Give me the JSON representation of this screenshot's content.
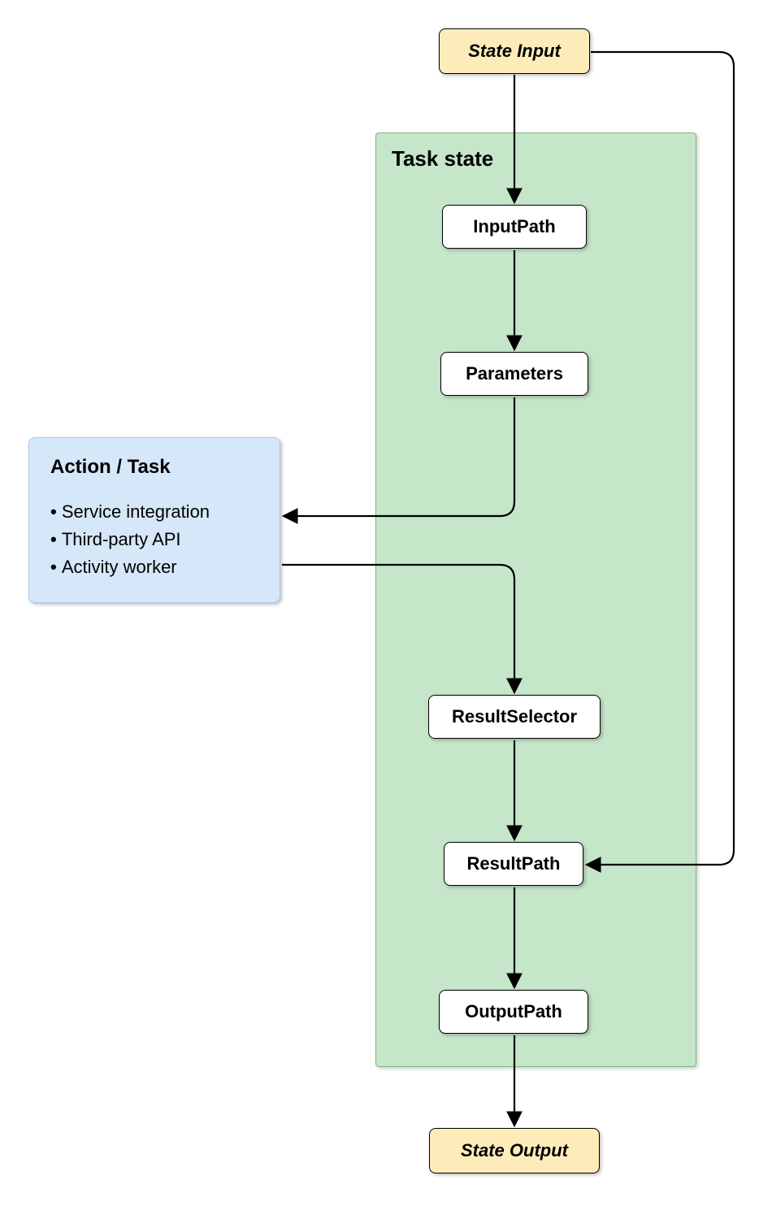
{
  "state_input": "State Input",
  "state_output": "State Output",
  "task_state": {
    "label": "Task state",
    "steps": {
      "input_path": "InputPath",
      "parameters": "Parameters",
      "result_selector": "ResultSelector",
      "result_path": "ResultPath",
      "output_path": "OutputPath"
    }
  },
  "action": {
    "title": "Action / Task",
    "items": [
      "Service integration",
      "Third-party API",
      "Activity worker"
    ]
  },
  "colors": {
    "state_io_bg": "#fdecba",
    "task_container_bg": "#c5e6c9",
    "action_bg": "#d5e7f8"
  }
}
